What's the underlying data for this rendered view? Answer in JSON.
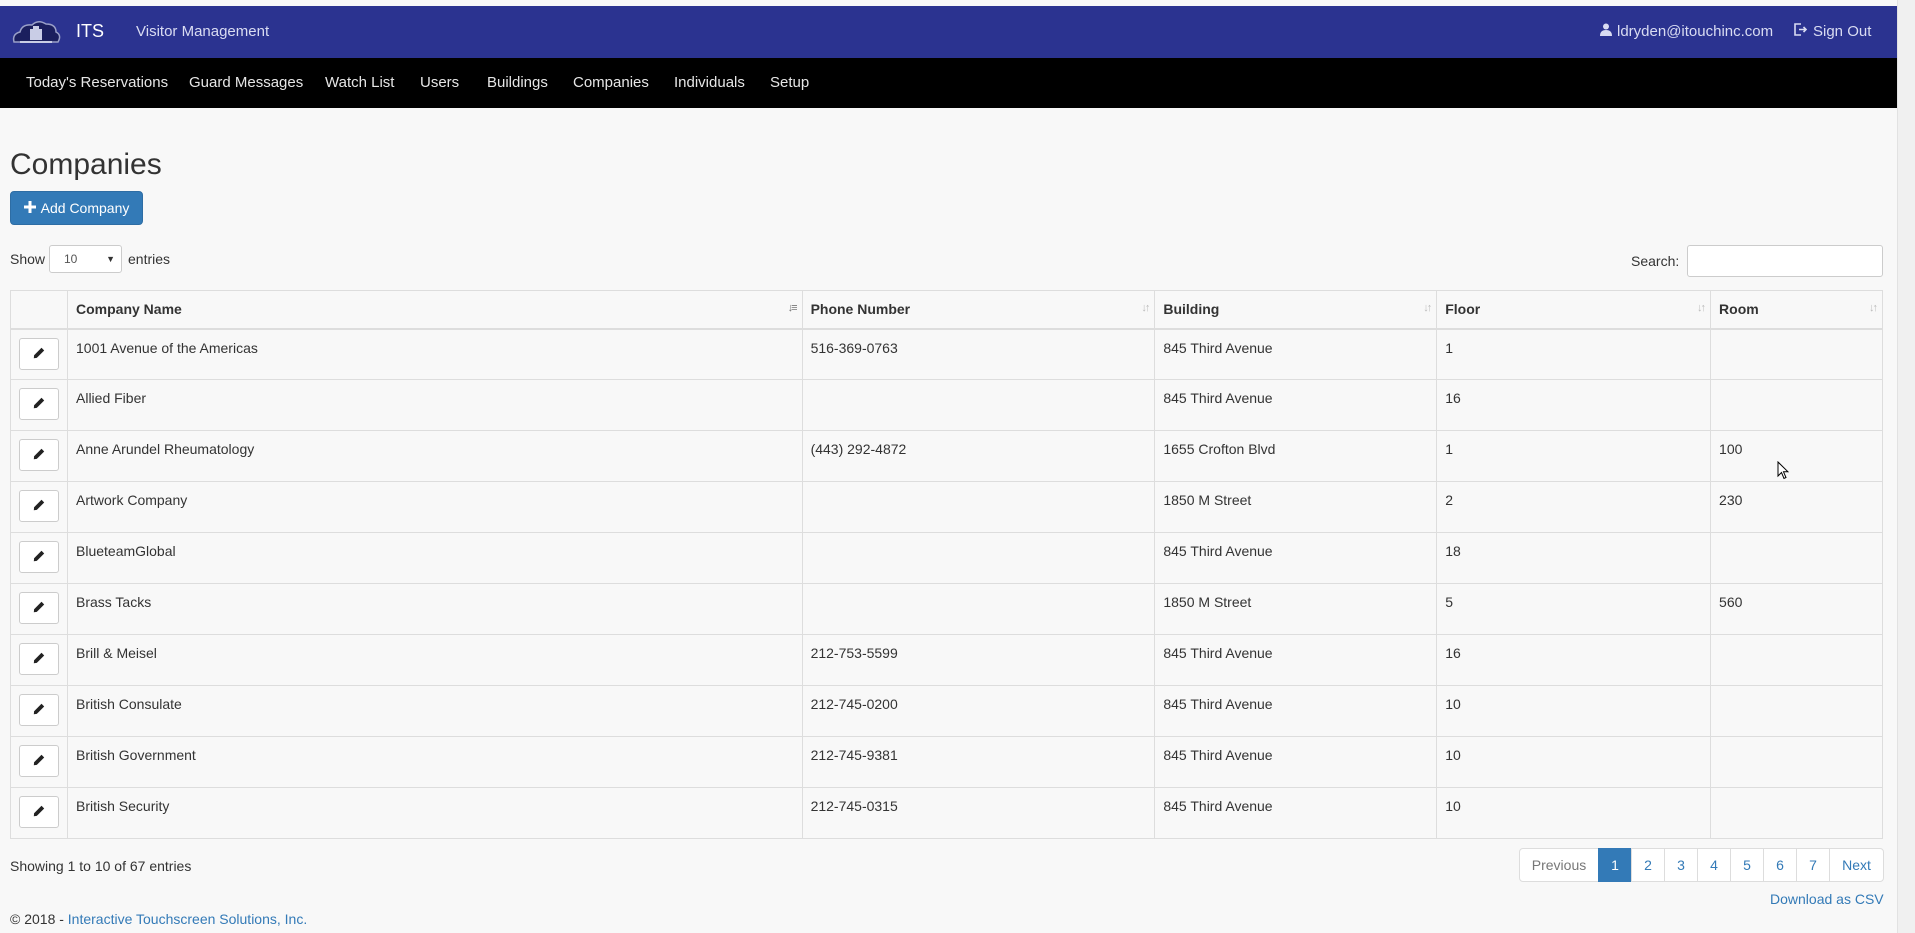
{
  "header": {
    "brand": "ITS",
    "subtitle": "Visitor Management",
    "user_email": "ldryden@itouchinc.com",
    "signout_label": "Sign Out",
    "color": "#2b3390"
  },
  "nav": {
    "items": [
      "Today's Reservations",
      "Guard Messages",
      "Watch List",
      "Users",
      "Buildings",
      "Companies",
      "Individuals",
      "Setup"
    ]
  },
  "page": {
    "title": "Companies",
    "add_button_label": "Add Company"
  },
  "table_controls": {
    "show_label": "Show",
    "entries_value": "10",
    "entries_label": "entries",
    "search_label": "Search:",
    "search_value": ""
  },
  "table": {
    "columns": [
      "Company Name",
      "Phone Number",
      "Building",
      "Floor",
      "Room"
    ],
    "rows": [
      [
        "1001 Avenue of the Americas",
        "516-369-0763",
        "845 Third Avenue",
        "1",
        ""
      ],
      [
        "Allied Fiber",
        "",
        "845 Third Avenue",
        "16",
        ""
      ],
      [
        "Anne Arundel Rheumatology",
        "(443) 292-4872",
        "1655 Crofton Blvd",
        "1",
        "100"
      ],
      [
        "Artwork Company",
        "",
        "1850 M Street",
        "2",
        "230"
      ],
      [
        "BlueteamGlobal",
        "",
        "845 Third Avenue",
        "18",
        ""
      ],
      [
        "Brass Tacks",
        "",
        "1850 M Street",
        "5",
        "560"
      ],
      [
        "Brill & Meisel",
        "212-753-5599",
        "845 Third Avenue",
        "16",
        ""
      ],
      [
        "British Consulate",
        "212-745-0200",
        "845 Third Avenue",
        "10",
        ""
      ],
      [
        "British Government",
        "212-745-9381",
        "845 Third Avenue",
        "10",
        ""
      ],
      [
        "British Security",
        "212-745-0315",
        "845 Third Avenue",
        "10",
        ""
      ]
    ]
  },
  "pagination": {
    "info": "Showing 1 to 10 of 67 entries",
    "previous": "Previous",
    "pages": [
      "1",
      "2",
      "3",
      "4",
      "5",
      "6",
      "7"
    ],
    "next": "Next",
    "current": "1"
  },
  "download_label": "Download as CSV",
  "footer": {
    "prefix": "© 2018 - ",
    "link": "Interactive Touchscreen Solutions, Inc."
  },
  "colors": {
    "accent": "#337ab7",
    "navbar": "#000000"
  }
}
